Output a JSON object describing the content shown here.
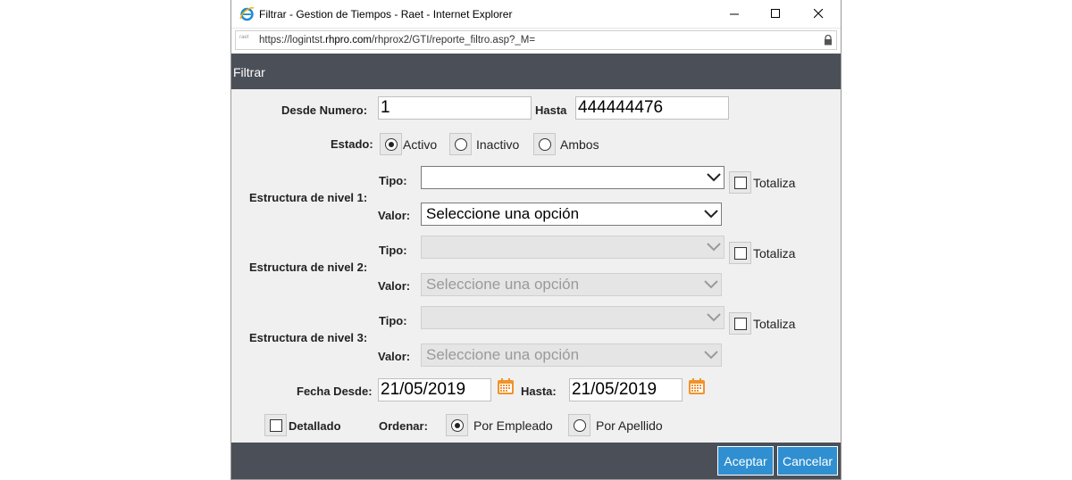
{
  "window": {
    "title": "Filtrar - Gestion de Tiempos - Raet - Internet Explorer",
    "minimize": "—",
    "maximize": "☐",
    "close": "✕"
  },
  "address": {
    "favicon_text": "raet",
    "url_prefix": "https://logintst.",
    "url_domain": "rhpro.com",
    "url_path": "/rhprox2/GTI/reporte_filtro.asp?_M="
  },
  "header": {
    "title": "Filtrar"
  },
  "form": {
    "desde_numero_label": "Desde Numero:",
    "desde_numero_value": "1",
    "hasta_label": "Hasta",
    "hasta_value": "444444476",
    "estado_label": "Estado:",
    "estado_options": [
      "Activo",
      "Inactivo",
      "Ambos"
    ],
    "estado_selected": "Activo",
    "tipo_label": "Tipo:",
    "valor_label": "Valor:",
    "totaliza_label": "Totaliza",
    "estructuras": [
      {
        "label": "Estructura de nivel 1:",
        "tipo_value": "",
        "valor_value": "Seleccione una opción",
        "enabled": true
      },
      {
        "label": "Estructura de nivel 2:",
        "tipo_value": "",
        "valor_value": "Seleccione una opción",
        "enabled": false
      },
      {
        "label": "Estructura de nivel 3:",
        "tipo_value": "",
        "valor_value": "Seleccione una opción",
        "enabled": false
      }
    ],
    "fecha_desde_label": "Fecha Desde:",
    "fecha_desde_value": "21/05/2019",
    "fecha_hasta_label": "Hasta:",
    "fecha_hasta_value": "21/05/2019",
    "detallado_label": "Detallado",
    "ordenar_label": "Ordenar:",
    "ordenar_options": [
      "Por Empleado",
      "Por Apellido"
    ],
    "ordenar_selected": "Por Empleado"
  },
  "footer": {
    "aceptar": "Aceptar",
    "cancelar": "Cancelar"
  },
  "colors": {
    "header_bg": "#4b4f58",
    "button_bg": "#2f8fd0",
    "calendar_icon": "#f0922b"
  }
}
